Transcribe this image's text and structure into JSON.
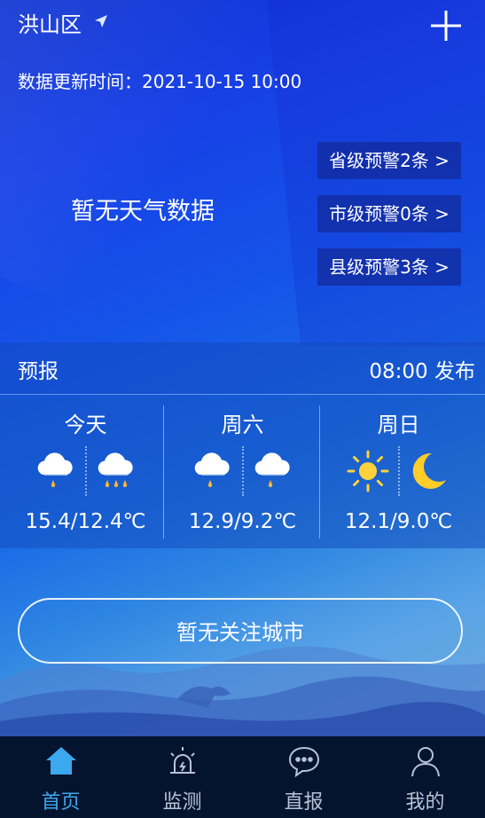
{
  "header": {
    "city": "洪山区",
    "update_text": "数据更新时间：2021-10-15 10:00"
  },
  "current": {
    "no_data_text": "暂无天气数据"
  },
  "warnings": [
    {
      "label": "省级预警2条 >"
    },
    {
      "label": "市级预警0条 >"
    },
    {
      "label": "县级预警3条 >"
    }
  ],
  "forecast": {
    "title": "预报",
    "publish_time": "08:00 发布",
    "days": [
      {
        "name": "今天",
        "day_icon": "cloud-light-rain-icon",
        "night_icon": "cloud-moderate-rain-icon",
        "temp": "15.4/12.4℃"
      },
      {
        "name": "周六",
        "day_icon": "cloud-light-rain-icon",
        "night_icon": "cloud-light-rain-icon",
        "temp": "12.9/9.2℃"
      },
      {
        "name": "周日",
        "day_icon": "sun-icon",
        "night_icon": "moon-icon",
        "temp": "12.1/9.0℃"
      }
    ]
  },
  "follow": {
    "label": "暂无关注城市"
  },
  "nav": {
    "items": [
      {
        "label": "首页",
        "icon": "home-icon",
        "active": true
      },
      {
        "label": "监测",
        "icon": "alarm-light-icon",
        "active": false
      },
      {
        "label": "直报",
        "icon": "chat-icon",
        "active": false
      },
      {
        "label": "我的",
        "icon": "user-icon",
        "active": false
      }
    ]
  },
  "colors": {
    "nav_active": "#3ca8f0",
    "nav_inactive": "#b8c2d6",
    "nav_bg": "#05142e",
    "sun": "#ffd23c",
    "moon": "#ffcc2a",
    "rain_drop": "#ffb830"
  }
}
